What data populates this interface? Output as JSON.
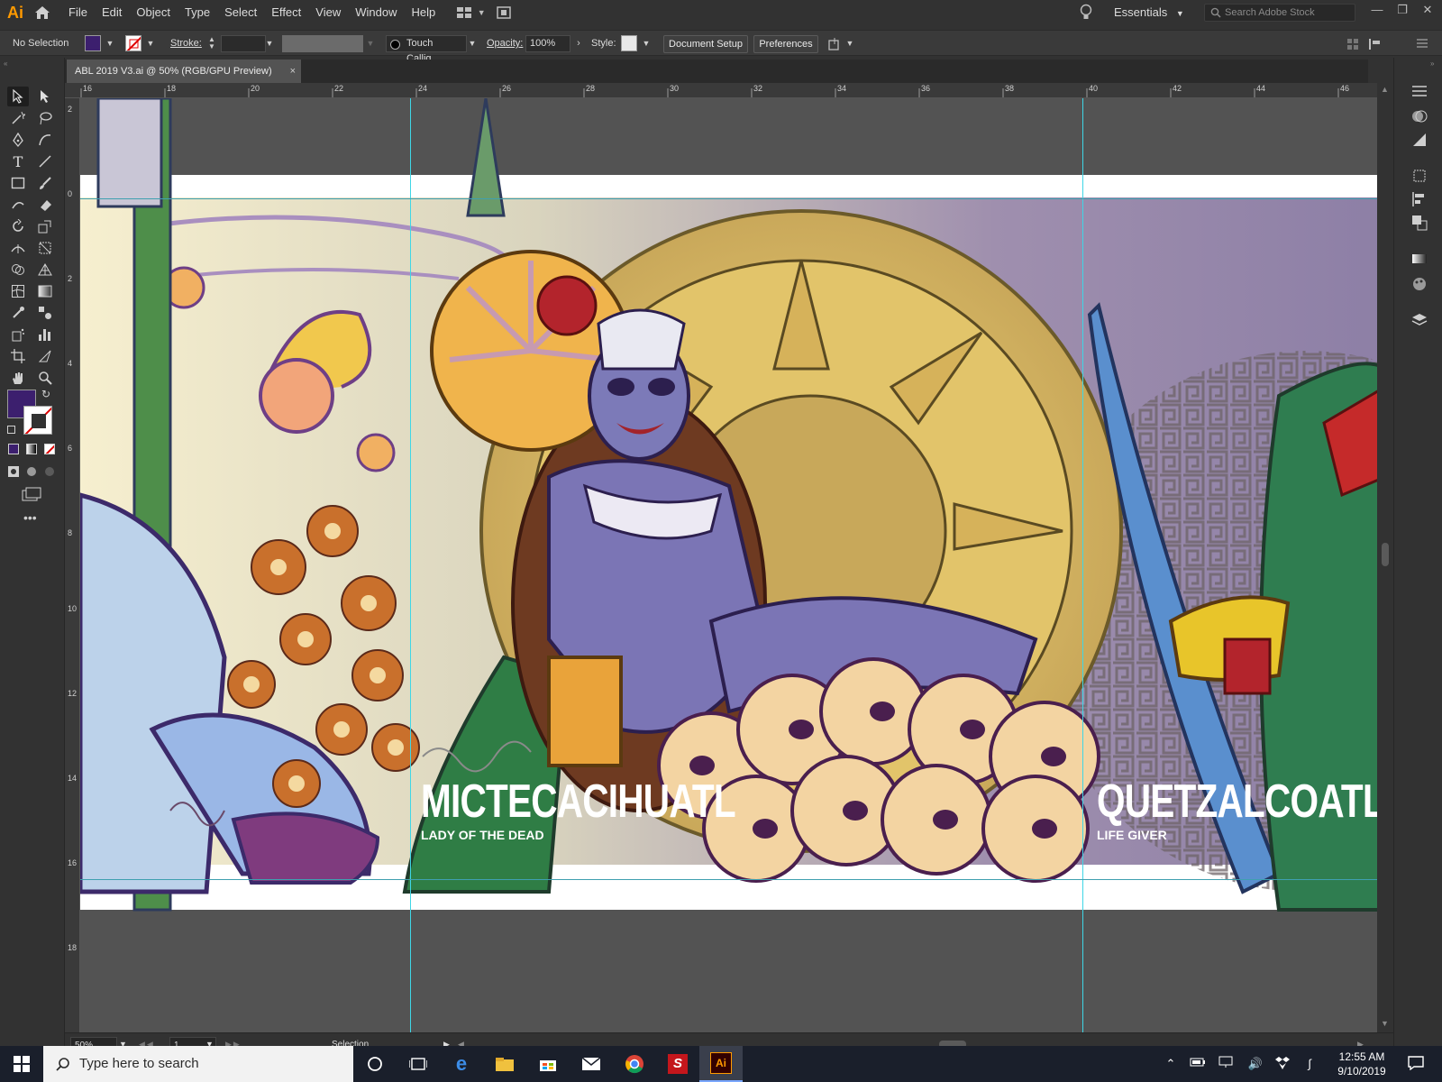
{
  "app": {
    "logo": "Ai",
    "menus": [
      "File",
      "Edit",
      "Object",
      "Type",
      "Select",
      "Effect",
      "View",
      "Window",
      "Help"
    ],
    "workspace": "Essentials",
    "search_placeholder": "Search Adobe Stock",
    "accent_color": "#ff9a00"
  },
  "control_bar": {
    "selection": "No Selection",
    "fill_color": "#3c1f6e",
    "stroke_label": "Stroke:",
    "brush_name": "Touch Callig...",
    "opacity_label": "Opacity:",
    "opacity_value": "100%",
    "style_label": "Style:",
    "document_setup": "Document Setup",
    "preferences": "Preferences"
  },
  "document": {
    "tab_title": "ABL 2019 V3.ai @ 50% (RGB/GPU Preview)",
    "close": "×"
  },
  "rulers": {
    "horizontal": [
      "16",
      "18",
      "20",
      "22",
      "24",
      "26",
      "28",
      "30",
      "32",
      "34",
      "36",
      "38",
      "40",
      "42",
      "44",
      "46"
    ],
    "vertical": [
      "2",
      "0",
      "2",
      "4",
      "6",
      "8",
      "10",
      "12",
      "14",
      "16",
      "18"
    ]
  },
  "artwork": {
    "left_title": "MICTECACIHUATL",
    "left_subtitle": "LADY OF THE DEAD",
    "right_title": "QUETZALCOATL",
    "right_subtitle": "LIFE GIVER"
  },
  "status_bar": {
    "zoom": "50%",
    "page": "1",
    "tool": "Selection"
  },
  "taskbar": {
    "search_placeholder": "Type here to search",
    "time": "12:55 AM",
    "date": "9/10/2019"
  }
}
